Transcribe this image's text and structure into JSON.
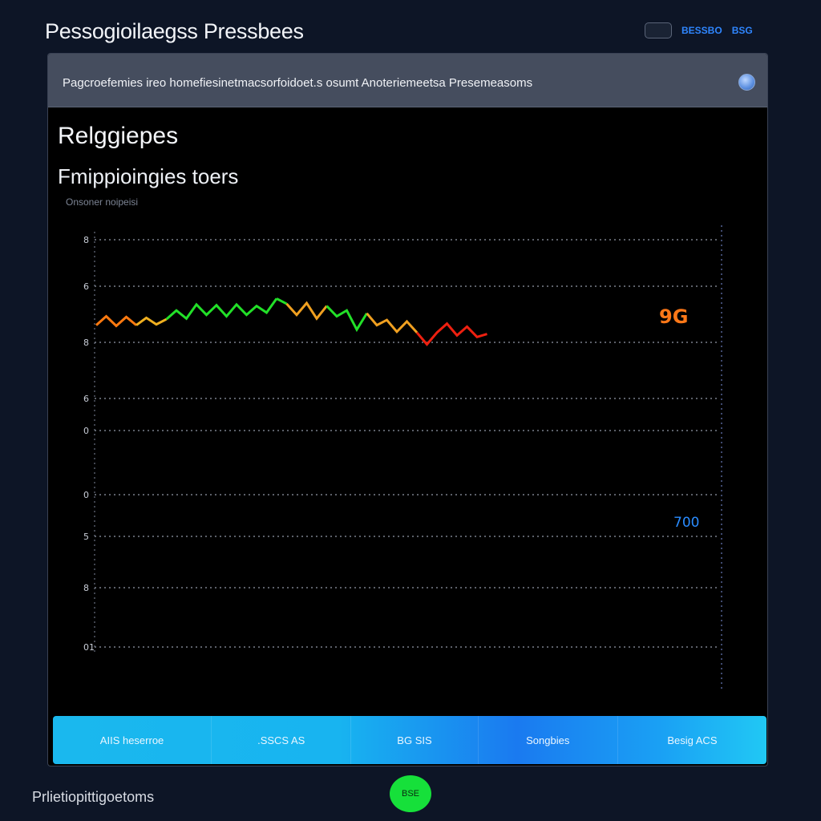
{
  "app": {
    "title": "Pessogioilaegss Pressbees"
  },
  "top_bar": {
    "link_1": "BESSBO",
    "link_2": "BSG"
  },
  "panel": {
    "header_text": "Pagcroefemies ireo homefiesinetmacsorfoidoet.s osumt Anoteriemeetsa Presemeasoms",
    "section_title": "Relggiepes",
    "section_subtitle": "Fmippioingies toers",
    "caption": "Onsoner noipeisi"
  },
  "chart_data": {
    "type": "line",
    "y_tick_labels": [
      "8",
      "6",
      "8",
      "6",
      "0",
      "0",
      "5",
      "8",
      "01"
    ],
    "grid": true,
    "series": [
      {
        "segments": [
          {
            "color": "#ff7a10",
            "x": [
              0,
              1,
              2,
              3,
              4
            ],
            "y": [
              3.2,
              4.4,
              3.1,
              4.3,
              3.2
            ]
          },
          {
            "color": "#f0b020",
            "x": [
              4,
              5,
              6,
              7
            ],
            "y": [
              3.2,
              4.2,
              3.3,
              4.0
            ]
          },
          {
            "color": "#22e028",
            "x": [
              7,
              8,
              9,
              10,
              11,
              12,
              13,
              14,
              15,
              16,
              17,
              18
            ],
            "y": [
              4.0,
              5.2,
              4.1,
              6.0,
              4.6,
              5.9,
              4.4,
              6.0,
              4.6,
              5.8,
              4.9,
              6.8
            ]
          },
          {
            "color": "#22e028",
            "x": [
              18,
              19
            ],
            "y": [
              6.8,
              6.1
            ]
          },
          {
            "color": "#f0a020",
            "x": [
              19,
              20,
              21,
              22,
              23
            ],
            "y": [
              6.1,
              4.6,
              6.2,
              4.1,
              5.8
            ]
          },
          {
            "color": "#22e028",
            "x": [
              23,
              24,
              25,
              26,
              27
            ],
            "y": [
              5.8,
              4.4,
              5.2,
              2.6,
              4.8
            ]
          },
          {
            "color": "#f0a020",
            "x": [
              27,
              28,
              29,
              30,
              31,
              32
            ],
            "y": [
              4.8,
              3.2,
              3.9,
              2.3,
              3.7,
              2.2
            ]
          },
          {
            "color": "#ee2010",
            "x": [
              32,
              33,
              34,
              35,
              36,
              37,
              38,
              39
            ],
            "y": [
              2.2,
              0.6,
              2.2,
              3.4,
              1.8,
              3.0,
              1.6,
              2.0
            ]
          }
        ]
      }
    ],
    "annotations": [
      {
        "text": "9G",
        "color": "#ff7818"
      },
      {
        "text": "700",
        "color": "#2a8cff"
      }
    ]
  },
  "tabs": [
    {
      "label": "AIIS heserroe"
    },
    {
      "label": ".SSCS AS"
    },
    {
      "label": "BG SIS"
    },
    {
      "label": "Songbies"
    },
    {
      "label": "Besig ACS"
    }
  ],
  "footer": {
    "text": "Prlietiopittigoetoms",
    "green_button": "BSE"
  }
}
